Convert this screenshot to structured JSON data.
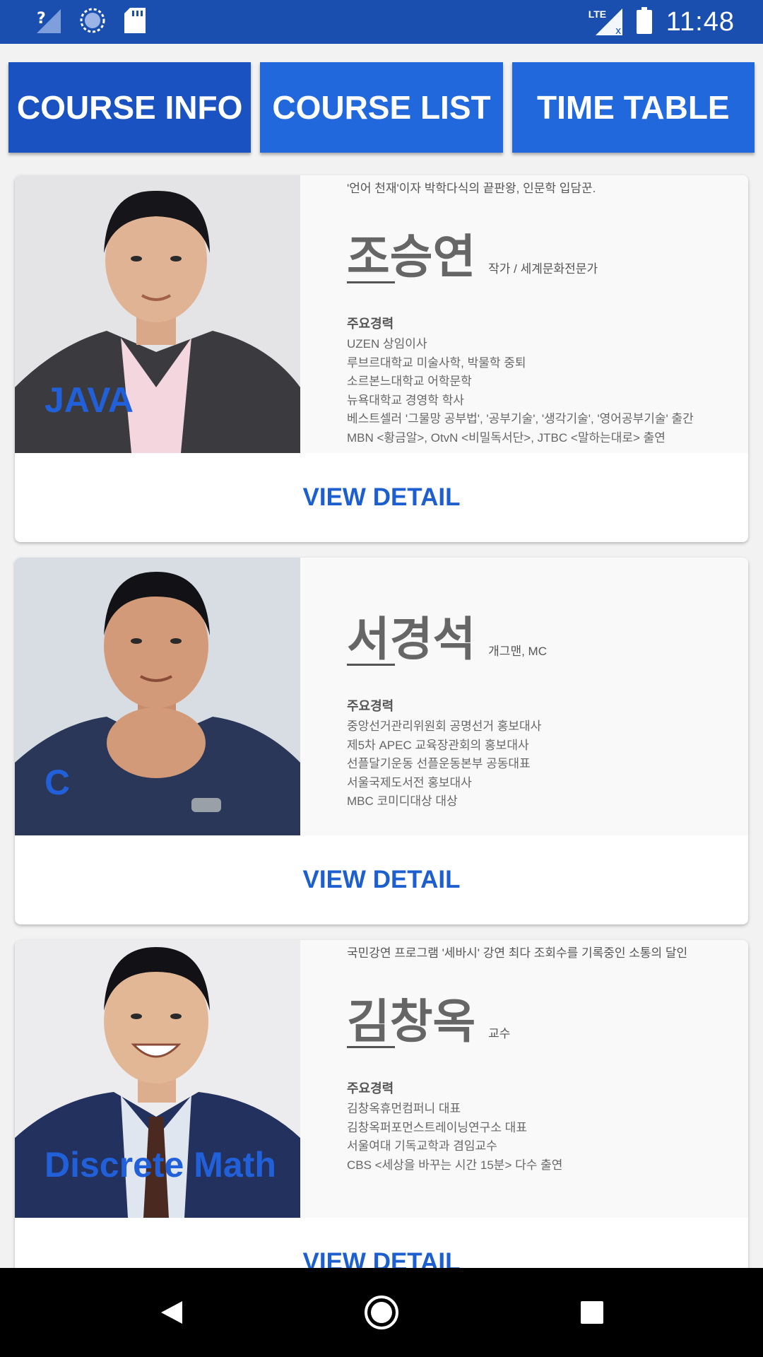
{
  "status_bar": {
    "time": "11:48",
    "network": "LTE",
    "icons": [
      "help-signal-icon",
      "sync-icon",
      "sd-card-icon",
      "lte-signal-icon",
      "battery-icon"
    ]
  },
  "tabs": [
    {
      "label": "COURSE INFO",
      "active": true
    },
    {
      "label": "COURSE LIST",
      "active": false
    },
    {
      "label": "TIME TABLE",
      "active": false
    }
  ],
  "courses": [
    {
      "course": "JAVA",
      "tagline": "'언어 천재'이자 박학다식의 끝판왕, 인문학 입담꾼.",
      "name": "조승연",
      "role": "작가 / 세계문화전문가",
      "career_title": "주요경력",
      "career": [
        "UZEN 상임이사",
        "루브르대학교 미술사학, 박물학 중퇴",
        "소르본느대학교 어학문학",
        "뉴욕대학교 경영학 학사",
        "베스트셀러 '그물망 공부법', '공부기술', '생각기술', '영어공부기술' 출간",
        "MBN <황금알>, OtvN <비밀독서단>, JTBC <말하는대로> 출연"
      ],
      "action": "VIEW DETAIL"
    },
    {
      "course": "C",
      "tagline": "",
      "name": "서경석",
      "role": "개그맨, MC",
      "career_title": "주요경력",
      "career": [
        "중앙선거관리위원회 공명선거 홍보대사",
        "제5차 APEC 교육장관회의 홍보대사",
        "선플달기운동 선플운동본부 공동대표",
        "서울국제도서전 홍보대사",
        "MBC 코미디대상 대상"
      ],
      "action": "VIEW DETAIL"
    },
    {
      "course": "Discrete Math",
      "tagline": "국민강연 프로그램 '세바시' 강연 최다 조회수를 기록중인 소통의 달인",
      "name": "김창옥",
      "role": "교수",
      "career_title": "주요경력",
      "career": [
        "김창옥휴먼컴퍼니 대표",
        "김창옥퍼포먼스트레이닝연구소 대표",
        "서울여대 기독교학과 겸임교수",
        "CBS <세상을 바꾸는 시간 15분> 다수 출연"
      ],
      "action": "VIEW DETAIL"
    }
  ],
  "nav_bar": {
    "icons": [
      "back-icon",
      "home-icon",
      "recents-icon"
    ]
  }
}
